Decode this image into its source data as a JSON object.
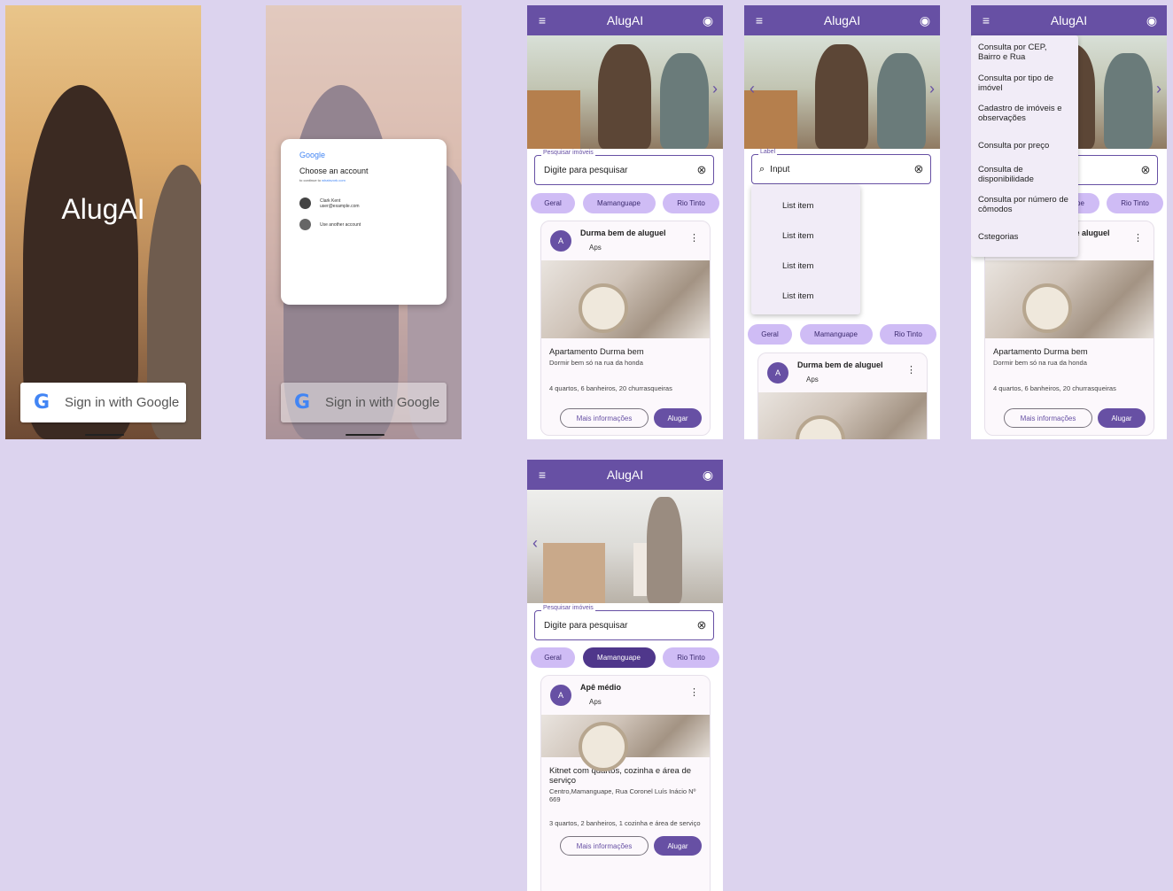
{
  "login": {
    "title": "AlugAI",
    "google_button": "Sign in with Google"
  },
  "account_dialog": {
    "brand": "Google",
    "heading": "Choose an account",
    "subheading_prefix": "to continue to",
    "subheading_site": "whatsvork.com",
    "accounts": [
      {
        "name": "Clark Kent",
        "email": "user@example.com"
      },
      {
        "name": "Use another account",
        "email": ""
      }
    ]
  },
  "app": {
    "title": "AlugAI"
  },
  "search": {
    "label": "Pesquisar imóveis",
    "placeholder": "Digite para pesquisar",
    "active_label": "Label",
    "active_value": "Input"
  },
  "chips": [
    "Geral",
    "Mamanguape",
    "Rio Tinto"
  ],
  "dropdown_items": [
    "List item",
    "List item",
    "List item",
    "List item"
  ],
  "nav_menu": [
    "Consulta por CEP, Bairro e Rua",
    "Consulta por tipo de imóvel",
    "Cadastro de imóveis e observações",
    "Consulta por preço",
    "Consulta de disponibilidade",
    "Consulta por número de cômodos",
    "Cstegorias"
  ],
  "card_a": {
    "avatar": "A",
    "title": "Durma bem de aluguel",
    "subtitle": "Aps",
    "heading": "Apartamento Durma bem",
    "desc": "Dormir bem só na rua da honda",
    "features": "4 quartos, 6 banheiros, 20 churrasqueiras",
    "more_button": "Mais informações",
    "rent_button": "Alugar"
  },
  "card_b": {
    "avatar": "A",
    "title": "Apê médio",
    "subtitle": "Aps",
    "heading": "Kitnet com quartos, cozinha e área de serviço",
    "desc": "Centro,Mamanguape, Rua Coronel Luís Inácio Nº 669",
    "features": "3 quartos, 2 banheiros, 1 cozinha e área de serviço",
    "more_button": "Mais informações",
    "rent_button": "Alugar"
  },
  "icons": {
    "menu": "menu-icon",
    "account": "account-circle-icon",
    "search": "search-icon",
    "clear": "clear-icon",
    "more": "more-vert-icon"
  },
  "colors": {
    "primary": "#6750a4",
    "chip": "#cfbcf5",
    "chip_selected": "#4f378b",
    "background": "#dcd3ee"
  }
}
